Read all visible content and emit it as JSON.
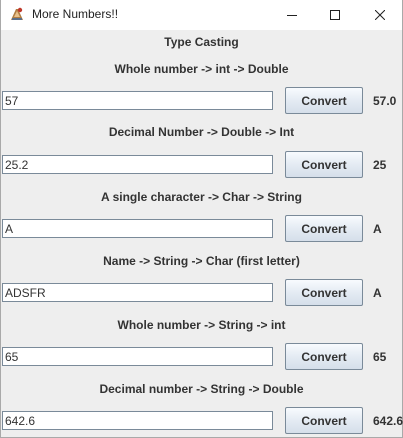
{
  "window": {
    "title": "More Numbers!!",
    "controls": {
      "minimize_icon": "minimize-icon",
      "maximize_icon": "maximize-icon",
      "close_icon": "close-icon"
    }
  },
  "main": {
    "header": "Type Casting",
    "rows": [
      {
        "label": "Whole number -> int -> Double",
        "value": "57",
        "button": "Convert",
        "result": "57.0"
      },
      {
        "label": "Decimal Number -> Double -> Int",
        "value": "25.2",
        "button": "Convert",
        "result": "25"
      },
      {
        "label": "A single character -> Char -> String",
        "value": "A",
        "button": "Convert",
        "result": "A"
      },
      {
        "label": "Name -> String -> Char (first letter)",
        "value": "ADSFR",
        "button": "Convert",
        "result": "A"
      },
      {
        "label": "Whole number -> String -> int",
        "value": "65",
        "button": "Convert",
        "result": "65"
      },
      {
        "label": "Decimal number -> String -> Double",
        "value": "642.6",
        "button": "Convert",
        "result": "642.6"
      }
    ]
  },
  "colors": {
    "panel": "#eeeeee",
    "text": "#333333",
    "field_border": "#7a8a99"
  }
}
